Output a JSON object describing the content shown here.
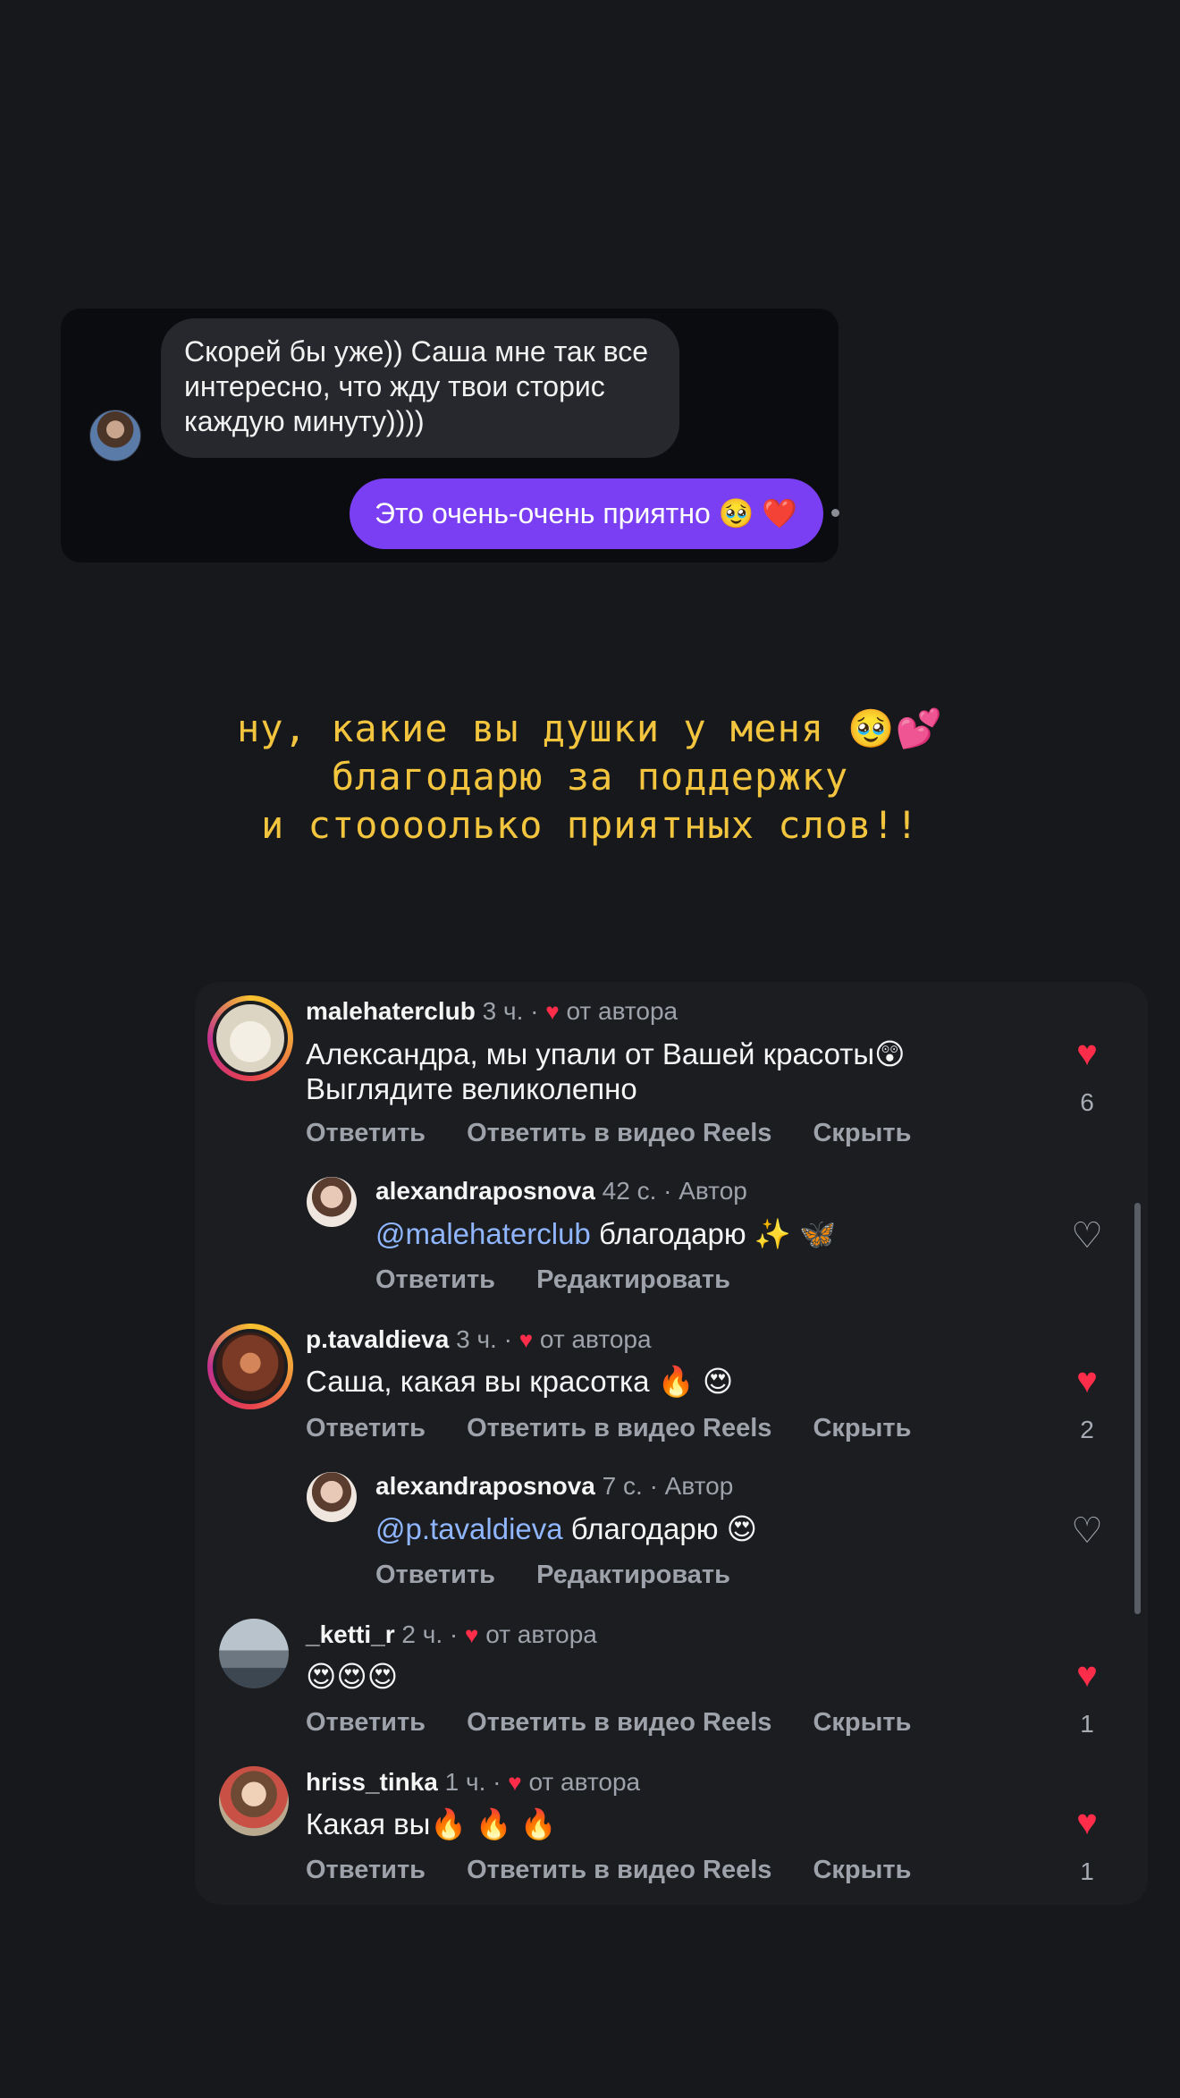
{
  "dm": {
    "incoming": "Скорей бы уже)) Саша мне так все интересно, что жду твои сторис каждую минуту))))",
    "outgoing": "Это очень-очень приятно 🥹 ❤️"
  },
  "caption": {
    "line1": "ну, какие вы душки у меня 🥹💕",
    "line2": "благодарю за поддержку",
    "line3": "и стоооолько приятных слов!!"
  },
  "labels": {
    "reply": "Ответить",
    "reply_reels": "Ответить в видео Reels",
    "hide": "Скрыть",
    "edit": "Редактировать",
    "heart": "♥",
    "heart_outline": "♡"
  },
  "comments": [
    {
      "username": "malehaterclub",
      "time": "3 ч. ·",
      "author_like": "от автора",
      "text_line1": "Александра, мы упали от Вашей красоты😲",
      "text_line2": "Выглядите великолепно",
      "likes": "6"
    },
    {
      "username": "alexandraposnova",
      "time": "42 с. · Автор",
      "mention": "@malehaterclub",
      "text": " благодарю ✨ 🦋"
    },
    {
      "username": "p.tavaldieva",
      "time": "3 ч. ·",
      "author_like": "от автора",
      "text": "Саша, какая вы красотка 🔥 😍",
      "likes": "2"
    },
    {
      "username": "alexandraposnova",
      "time": "7 с. · Автор",
      "mention": "@p.tavaldieva",
      "text": " благодарю 😍"
    },
    {
      "username": "_ketti_r",
      "time": "2 ч. ·",
      "author_like": "от автора",
      "text": "😍😍😍",
      "likes": "1"
    },
    {
      "username": "hriss_tinka",
      "time": "1 ч. ·",
      "author_like": "от автора",
      "text": "Какая вы🔥 🔥 🔥",
      "likes": "1"
    }
  ],
  "colors": {
    "background": "#16181c",
    "caption": "#f3c53f",
    "outgoing_bubble": "#7a3ff2",
    "like_red": "#ff2d4a",
    "mention": "#8fb6ff"
  }
}
